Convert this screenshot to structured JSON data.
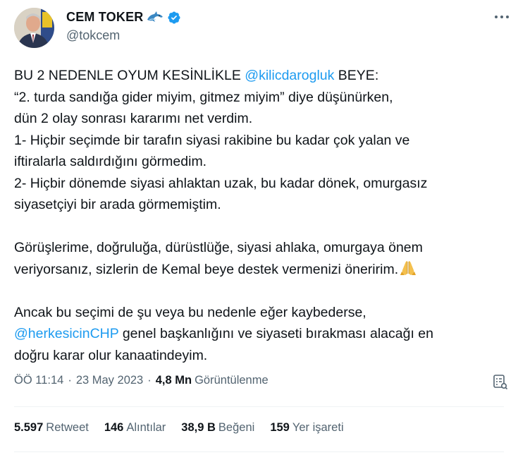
{
  "author": {
    "display_name": "CEM TOKER",
    "handle": "@tokcem",
    "dolphin_emoji": "dolphin-icon",
    "verified_icon": "verified-badge-icon",
    "verified_color": "#1d9bf0"
  },
  "tweet": {
    "lines": [
      {
        "pre": "BU 2 NEDENLE OYUM KESİNLİKLE  ",
        "mention": "@kilicdarogluk",
        "post": " BEYE:"
      },
      {
        "text": "“2. turda sandığa gider miyim, gitmez miyim” diye düşünürken,"
      },
      {
        "text": "dün 2 olay sonrası kararımı net verdim."
      },
      {
        "text": "1- Hiçbir seçimde bir tarafın siyasi rakibine bu kadar çok yalan ve"
      },
      {
        "text": "iftiralarla saldırdığını görmedim."
      },
      {
        "text": "2- Hiçbir dönemde siyasi ahlaktan uzak, bu kadar dönek, omurgasız"
      },
      {
        "text": "siyasetçiyi bir arada görmemiştim."
      },
      {
        "text": "Görüşlerime, doğruluğa, dürüstlüğe, siyasi ahlaka, omurgaya önem"
      },
      {
        "text": "veriyorsanız, sizlerin de Kemal beye destek vermenizi öneririm."
      },
      {
        "text": "Ancak bu seçimi de şu veya bu nedenle eğer kaybederse,"
      },
      {
        "mention": "@herkesicinCHP",
        "post": " genel başkanlığını ve siyaseti bırakması alacağı en"
      },
      {
        "text": "doğru karar olur kanaatindeyim."
      }
    ],
    "pray_emoji": "folded-hands-icon",
    "mention_color": "#1d9bf0"
  },
  "meta": {
    "time": "ÖÖ 11:14",
    "separator": "·",
    "date": "23 May 2023",
    "views_count": "4,8 Mn",
    "views_label": "Görüntülenme",
    "analytics_icon": "analytics-icon"
  },
  "stats": {
    "retweets_count": "5.597",
    "retweets_label": "Retweet",
    "quotes_count": "146",
    "quotes_label": "Alıntılar",
    "likes_count": "38,9 B",
    "likes_label": "Beğeni",
    "bookmarks_count": "159",
    "bookmarks_label": "Yer işareti"
  }
}
